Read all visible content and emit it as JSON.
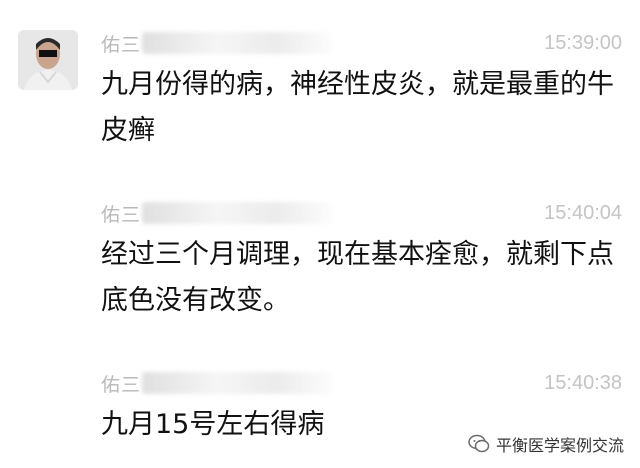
{
  "messages": [
    {
      "sender": "佑三",
      "time": "15:39:00",
      "text": "九月份得的病，神经性皮炎，就是最重的牛皮癣"
    },
    {
      "sender": "佑三",
      "time": "15:40:04",
      "text": "经过三个月调理，现在基本痊愈，就剩下点底色没有改变。"
    },
    {
      "sender": "佑三",
      "time": "15:40:38",
      "text": "九月15号左右得病"
    }
  ],
  "watermark": {
    "text": "平衡医学案例交流",
    "icon": "wechat-official-account-icon"
  }
}
